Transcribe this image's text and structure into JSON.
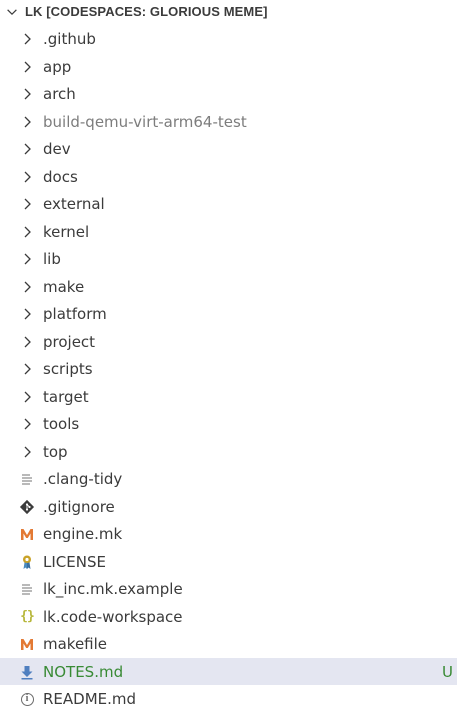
{
  "explorer": {
    "root_title": "LK [CODESPACES: GLORIOUS MEME]",
    "items": [
      {
        "label": ".github",
        "kind": "folder",
        "icon": "chevron-right-icon"
      },
      {
        "label": "app",
        "kind": "folder",
        "icon": "chevron-right-icon"
      },
      {
        "label": "arch",
        "kind": "folder",
        "icon": "chevron-right-icon"
      },
      {
        "label": "build-qemu-virt-arm64-test",
        "kind": "folder",
        "icon": "chevron-right-icon",
        "dimmed": true
      },
      {
        "label": "dev",
        "kind": "folder",
        "icon": "chevron-right-icon"
      },
      {
        "label": "docs",
        "kind": "folder",
        "icon": "chevron-right-icon"
      },
      {
        "label": "external",
        "kind": "folder",
        "icon": "chevron-right-icon"
      },
      {
        "label": "kernel",
        "kind": "folder",
        "icon": "chevron-right-icon"
      },
      {
        "label": "lib",
        "kind": "folder",
        "icon": "chevron-right-icon"
      },
      {
        "label": "make",
        "kind": "folder",
        "icon": "chevron-right-icon"
      },
      {
        "label": "platform",
        "kind": "folder",
        "icon": "chevron-right-icon"
      },
      {
        "label": "project",
        "kind": "folder",
        "icon": "chevron-right-icon"
      },
      {
        "label": "scripts",
        "kind": "folder",
        "icon": "chevron-right-icon"
      },
      {
        "label": "target",
        "kind": "folder",
        "icon": "chevron-right-icon"
      },
      {
        "label": "tools",
        "kind": "folder",
        "icon": "chevron-right-icon"
      },
      {
        "label": "top",
        "kind": "folder",
        "icon": "chevron-right-icon"
      },
      {
        "label": ".clang-tidy",
        "kind": "file",
        "icon": "text-file-icon"
      },
      {
        "label": ".gitignore",
        "kind": "file",
        "icon": "git-icon"
      },
      {
        "label": "engine.mk",
        "kind": "file",
        "icon": "makefile-m-icon"
      },
      {
        "label": "LICENSE",
        "kind": "file",
        "icon": "license-key-icon"
      },
      {
        "label": "lk_inc.mk.example",
        "kind": "file",
        "icon": "text-file-icon"
      },
      {
        "label": "lk.code-workspace",
        "kind": "file",
        "icon": "json-braces-icon"
      },
      {
        "label": "makefile",
        "kind": "file",
        "icon": "makefile-m-icon"
      },
      {
        "label": "NOTES.md",
        "kind": "file",
        "icon": "download-arrow-icon",
        "selected": true,
        "badge": "U"
      },
      {
        "label": "README.md",
        "kind": "file",
        "icon": "info-icon"
      }
    ]
  },
  "colors": {
    "selected_background": "#e4e6f1",
    "untracked_green": "#388a34",
    "dimmed_text": "#7d7d7d",
    "makefile_orange": "#e37933",
    "json_yellow": "#b7b73b",
    "markdown_blue": "#4f7fbf",
    "license_yellow": "#c9a227"
  }
}
